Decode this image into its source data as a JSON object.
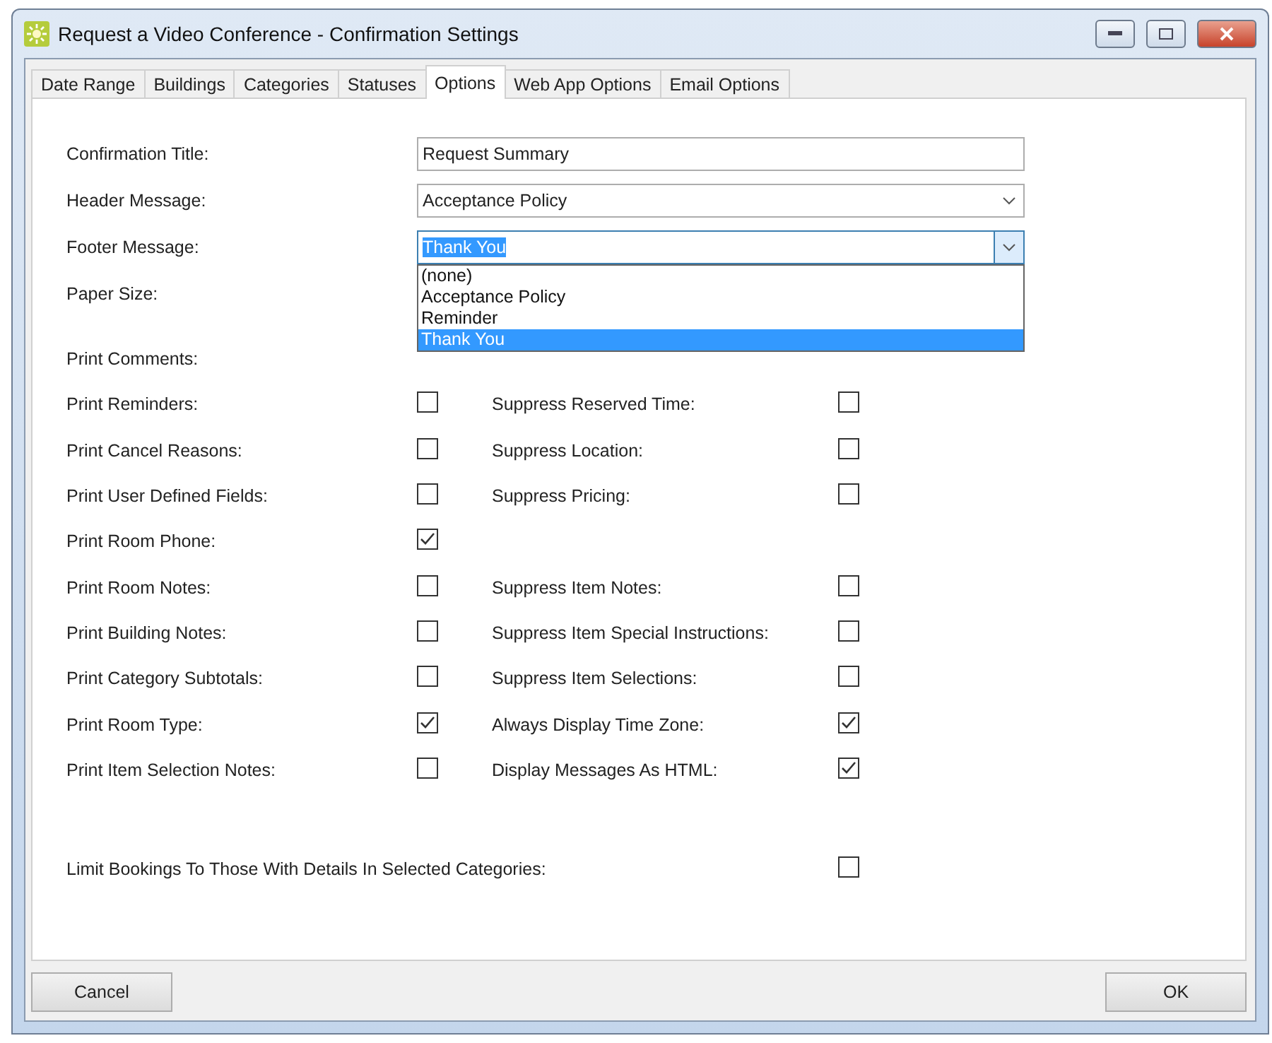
{
  "window": {
    "title": "Request a Video Conference - Confirmation Settings"
  },
  "tabs": [
    {
      "label": "Date Range",
      "selected": false
    },
    {
      "label": "Buildings",
      "selected": false
    },
    {
      "label": "Categories",
      "selected": false
    },
    {
      "label": "Statuses",
      "selected": false
    },
    {
      "label": "Options",
      "selected": true
    },
    {
      "label": "Web App Options",
      "selected": false
    },
    {
      "label": "Email Options",
      "selected": false
    }
  ],
  "fields": [
    {
      "label": "Confirmation Title:",
      "kind": "text",
      "value": "Request Summary"
    },
    {
      "label": "Header Message:",
      "kind": "combo",
      "value": "Acceptance Policy",
      "expanded": false
    },
    {
      "label": "Footer Message:",
      "kind": "combo",
      "value": "Thank You",
      "expanded": true,
      "options": [
        {
          "label": "(none)",
          "selected": false
        },
        {
          "label": "Acceptance Policy",
          "selected": false
        },
        {
          "label": "Reminder",
          "selected": false
        },
        {
          "label": "Thank You",
          "selected": true
        }
      ]
    },
    {
      "label": "Paper Size:",
      "kind": "covered"
    }
  ],
  "checks": [
    {
      "left": {
        "label": "Print Comments:"
      }
    },
    {
      "left": {
        "label": "Print Reminders:",
        "checked": false
      },
      "right": {
        "label": "Suppress Reserved Time:",
        "checked": false
      }
    },
    {
      "left": {
        "label": "Print Cancel Reasons:",
        "checked": false
      },
      "right": {
        "label": "Suppress Location:",
        "checked": false
      }
    },
    {
      "left": {
        "label": "Print User Defined Fields:",
        "checked": false
      },
      "right": {
        "label": "Suppress Pricing:",
        "checked": false
      }
    },
    {
      "left": {
        "label": "Print Room Phone:",
        "checked": true
      }
    },
    {
      "left": {
        "label": "Print Room Notes:",
        "checked": false
      },
      "right": {
        "label": "Suppress Item Notes:",
        "checked": false
      }
    },
    {
      "left": {
        "label": "Print Building Notes:",
        "checked": false
      },
      "right": {
        "label": "Suppress Item Special Instructions:",
        "checked": false
      }
    },
    {
      "left": {
        "label": "Print Category Subtotals:",
        "checked": false
      },
      "right": {
        "label": "Suppress Item Selections:",
        "checked": false
      }
    },
    {
      "left": {
        "label": "Print Room Type:",
        "checked": true
      },
      "right": {
        "label": "Always Display Time Zone:",
        "checked": true
      }
    },
    {
      "left": {
        "label": "Print Item Selection Notes:",
        "checked": false
      },
      "right": {
        "label": "Display Messages As HTML:",
        "checked": true
      }
    }
  ],
  "limit": {
    "label": "Limit Bookings To Those With Details In Selected Categories:",
    "checked": false
  },
  "buttons": [
    {
      "label": "Cancel"
    },
    {
      "label": "OK"
    }
  ]
}
